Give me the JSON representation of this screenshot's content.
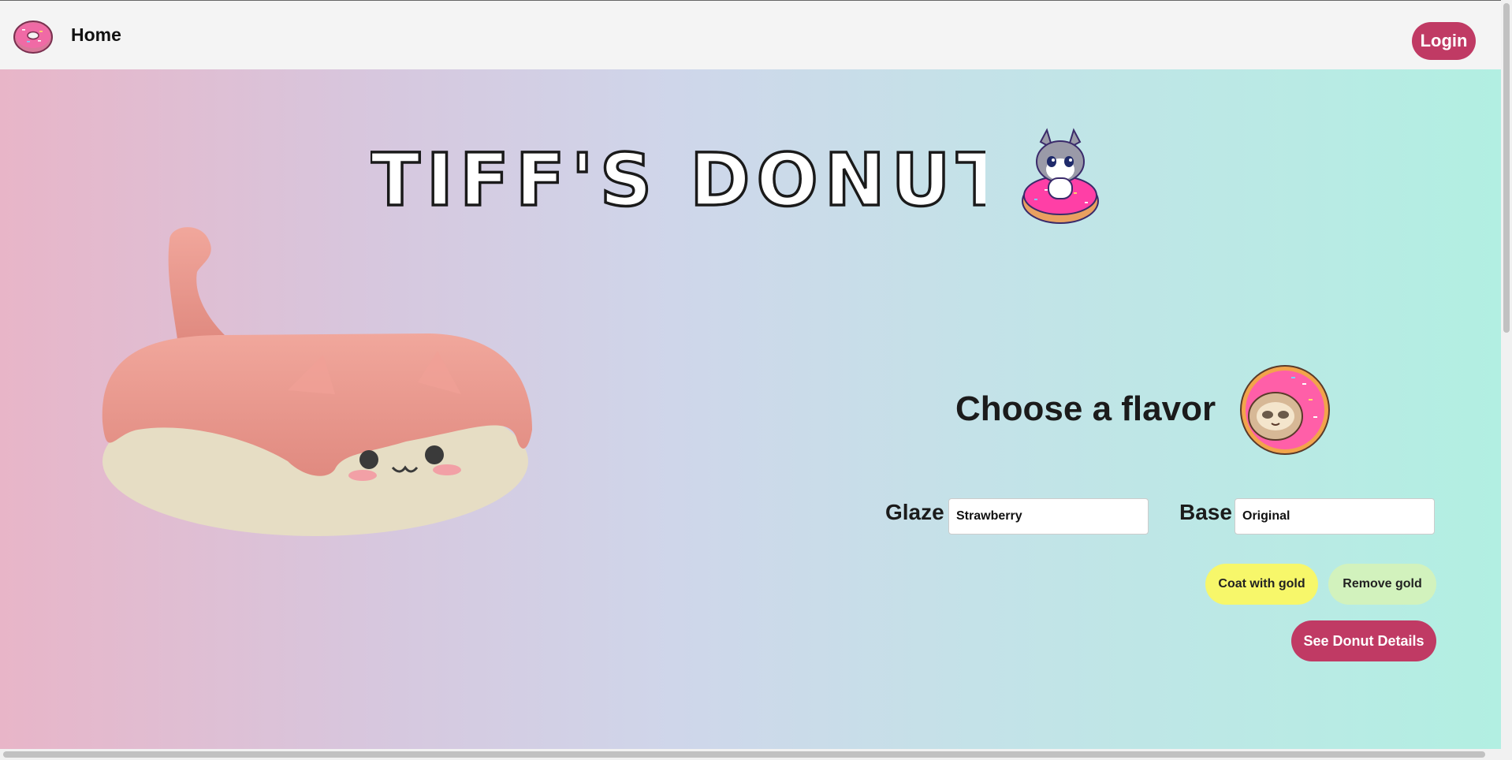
{
  "nav": {
    "home_label": "Home",
    "login_label": "Login"
  },
  "hero": {
    "title": "TIFF'S DONUTS"
  },
  "flavor": {
    "heading": "Choose a flavor",
    "glaze_label": "Glaze",
    "glaze_value": "Strawberry",
    "base_label": "Base",
    "base_value": "Original",
    "coat_gold_label": "Coat with gold",
    "remove_gold_label": "Remove gold",
    "details_label": "See Donut Details"
  },
  "colors": {
    "accent": "#c03a64",
    "coat_gold": "#f7f76a",
    "remove_gold": "#d2f2bd",
    "glaze_pink": "#e9998f",
    "donut_base": "#ece3c9"
  },
  "icons": [
    "donut-logo-icon",
    "cat-donut-icon",
    "sloth-donut-icon"
  ]
}
